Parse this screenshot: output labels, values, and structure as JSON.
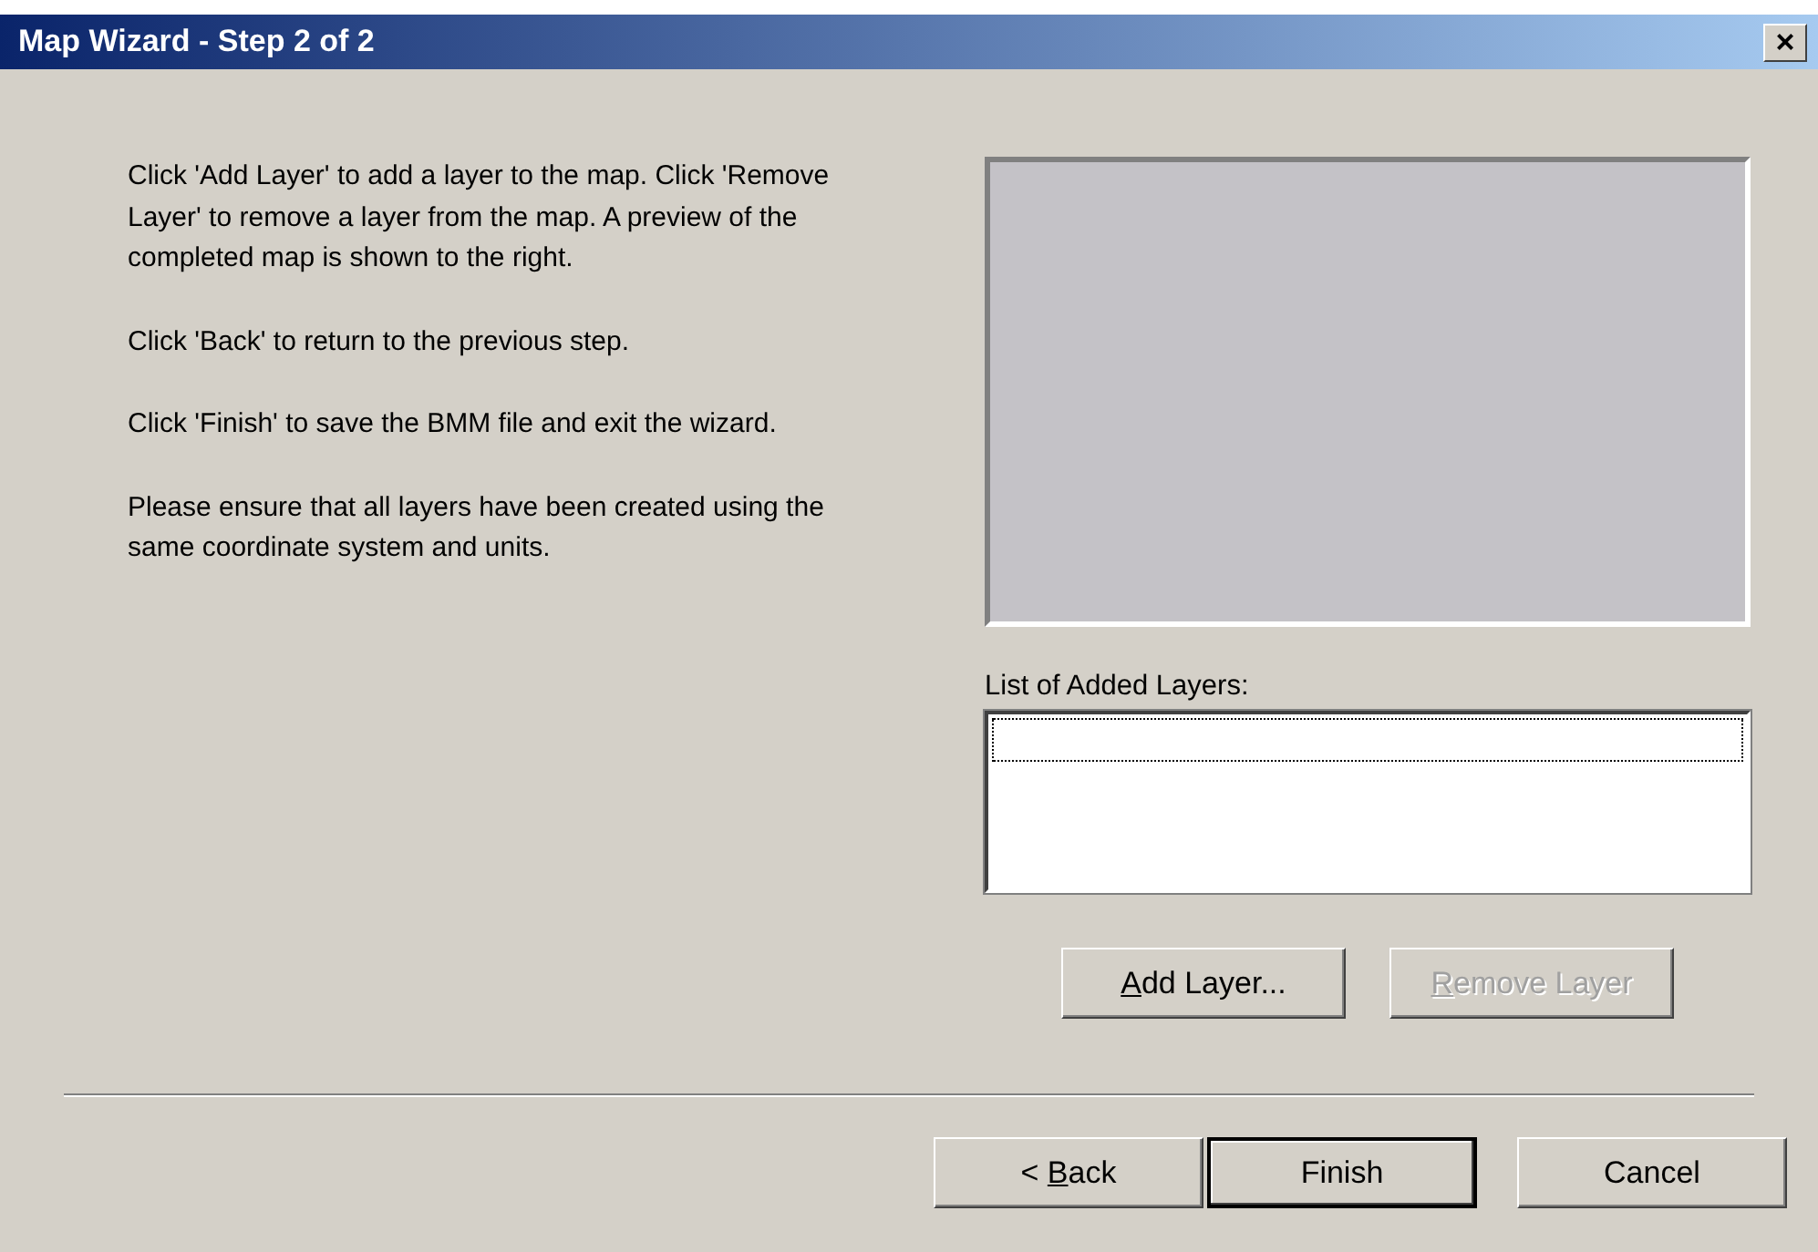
{
  "window": {
    "title": "Map Wizard - Step 2 of 2",
    "close": "×"
  },
  "instructions": [
    "Click 'Add Layer' to add a layer to the map. Click 'Remove Layer' to remove a layer from the map. A preview of the completed map is shown to the right.",
    "Click 'Back' to return to the previous step.",
    "Click 'Finish' to save the BMM file and exit the wizard.",
    "Please ensure that all layers have been created using the same coordinate system and units."
  ],
  "layers_list": {
    "label": "List of Added Layers:",
    "focused": true
  },
  "layer_buttons": [
    {
      "key": "A",
      "post": "dd Layer...",
      "disabled": false
    },
    {
      "key": "R",
      "post": "emove Layer",
      "disabled": true
    }
  ],
  "footer_buttons": [
    {
      "pre": "< ",
      "key": "B",
      "post": "ack",
      "default": false
    },
    {
      "pre": "Finish",
      "default": true
    },
    {
      "pre": "Cancel",
      "default": false
    }
  ]
}
